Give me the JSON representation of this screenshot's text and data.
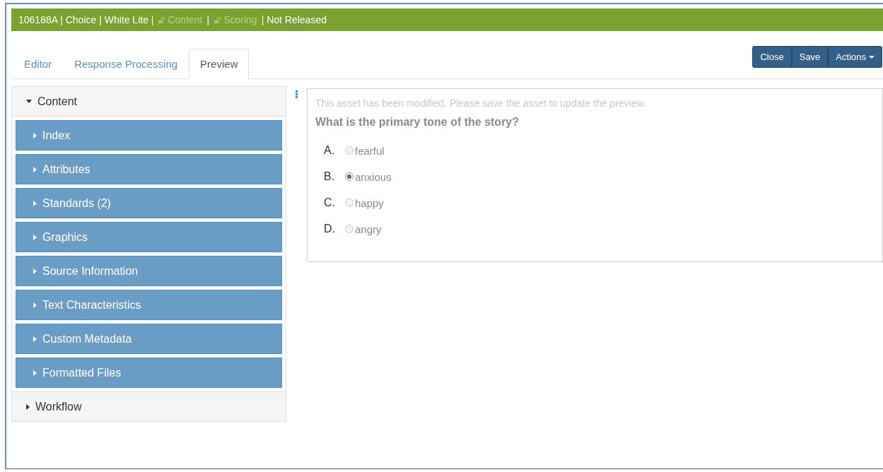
{
  "header": {
    "segments": [
      {
        "text": "106188A | Choice | White Lite |",
        "locked": false
      },
      {
        "text": "Content",
        "locked": true
      },
      {
        "text": "|",
        "locked": false
      },
      {
        "text": "Scoring",
        "locked": true
      },
      {
        "text": "| Not Released",
        "locked": false
      }
    ]
  },
  "tabs": [
    {
      "label": "Editor",
      "selected": false
    },
    {
      "label": "Response Processing",
      "selected": false
    },
    {
      "label": "Preview",
      "selected": true
    }
  ],
  "buttons": [
    {
      "label": "Close",
      "kind": "plain"
    },
    {
      "label": "Save",
      "kind": "plain"
    },
    {
      "label": "Actions",
      "kind": "dropdown"
    }
  ],
  "sidebar": {
    "sections": [
      {
        "label": "Content",
        "expanded": true,
        "items": [
          {
            "label": "Index"
          },
          {
            "label": "Attributes"
          },
          {
            "label": "Standards (2)"
          },
          {
            "label": "Graphics"
          },
          {
            "label": "Source Information"
          },
          {
            "label": "Text Characteristics"
          },
          {
            "label": "Custom Metadata"
          },
          {
            "label": "Formatted Files"
          }
        ]
      },
      {
        "label": "Workflow",
        "expanded": false
      }
    ]
  },
  "preview": {
    "notice": "This asset has been modified. Please save the asset to update the preview.",
    "question": "What is the primary tone of the story?",
    "options": [
      {
        "letter": "A.",
        "text": "fearful",
        "selected": false
      },
      {
        "letter": "B.",
        "text": "anxious",
        "selected": true
      },
      {
        "letter": "C.",
        "text": "happy",
        "selected": false
      },
      {
        "letter": "D.",
        "text": "angry",
        "selected": false
      }
    ]
  }
}
